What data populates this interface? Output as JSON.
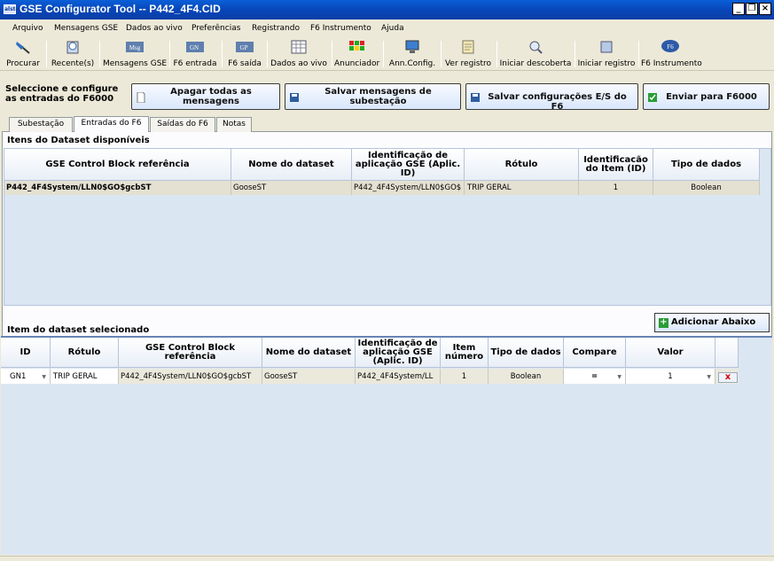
{
  "window": {
    "title": "GSE Configurator Tool -- P442_4F4.CID",
    "app_icon_text": "alstom"
  },
  "menu": [
    "Arquivo",
    "Mensagens GSE",
    "Dados ao vivo",
    "Preferências",
    "Registrando",
    "F6 Instrumento",
    "Ajuda"
  ],
  "toolbar": [
    {
      "label": "Procurar",
      "icon": "search-folder-icon"
    },
    {
      "label": "Recente(s)",
      "icon": "recent-icon"
    },
    {
      "label": "Mensagens GSE",
      "icon": "msg-icon",
      "icon_text": "Msg"
    },
    {
      "label": "F6 entrada",
      "icon": "gn-icon",
      "icon_text": "GN"
    },
    {
      "label": "F6 saída",
      "icon": "gp-icon",
      "icon_text": "GP"
    },
    {
      "label": "Dados ao vivo",
      "icon": "grid-icon"
    },
    {
      "label": "Anunciador",
      "icon": "annunciator-icon"
    },
    {
      "label": "Ann.Config.",
      "icon": "monitor-icon"
    },
    {
      "label": "Ver registro",
      "icon": "log-icon"
    },
    {
      "label": "Iniciar descoberta",
      "icon": "magnifier-icon"
    },
    {
      "label": "Iniciar registro",
      "icon": "record-icon"
    },
    {
      "label": "F6 Instrumento",
      "icon": "f6-icon",
      "icon_text": "F6"
    }
  ],
  "intro": {
    "line1": "Seleccione e configure",
    "line2": "as entradas do F6000"
  },
  "actions": {
    "clear": {
      "line1": "Apagar todas as",
      "line2": "mensagens"
    },
    "save_msgs": {
      "line1": "Salvar mensagens de",
      "line2": "subestação"
    },
    "save_io": "Salvar configurações E/S do F6",
    "send": "Enviar para F6000"
  },
  "tabs": [
    "Subestação",
    "Entradas do F6",
    "Saídas do F6",
    "Notas"
  ],
  "available": {
    "heading": "Itens do Dataset disponíveis",
    "headers": [
      "GSE Control Block referência",
      "Nome do dataset",
      "Identificação de aplicação GSE (Aplic. ID)",
      "Rótulo",
      "Identificacão do Item (ID)",
      "Tipo de dados"
    ],
    "rows": [
      [
        "P442_4F4System/LLN0$GO$gcbST",
        "GooseST",
        "P442_4F4System/LLN0$GO$",
        "TRIP GERAL",
        "1",
        "Boolean"
      ]
    ]
  },
  "add_button": "Adicionar Abaixo",
  "selected": {
    "heading": "Item do dataset selecionado",
    "headers": [
      "ID",
      "Rótulo",
      "GSE Control Block referência",
      "Nome do dataset",
      "Identificação de aplicação GSE (Aplic. ID)",
      "Item número",
      "Tipo de dados",
      "Compare",
      "Valor"
    ],
    "rows": [
      [
        "GN1",
        "TRIP GERAL",
        "P442_4F4System/LLN0$GO$gcbST",
        "GooseST",
        "P442_4F4System/LL",
        "1",
        "Boolean",
        "=",
        "1"
      ]
    ],
    "delete_glyph": "x"
  }
}
